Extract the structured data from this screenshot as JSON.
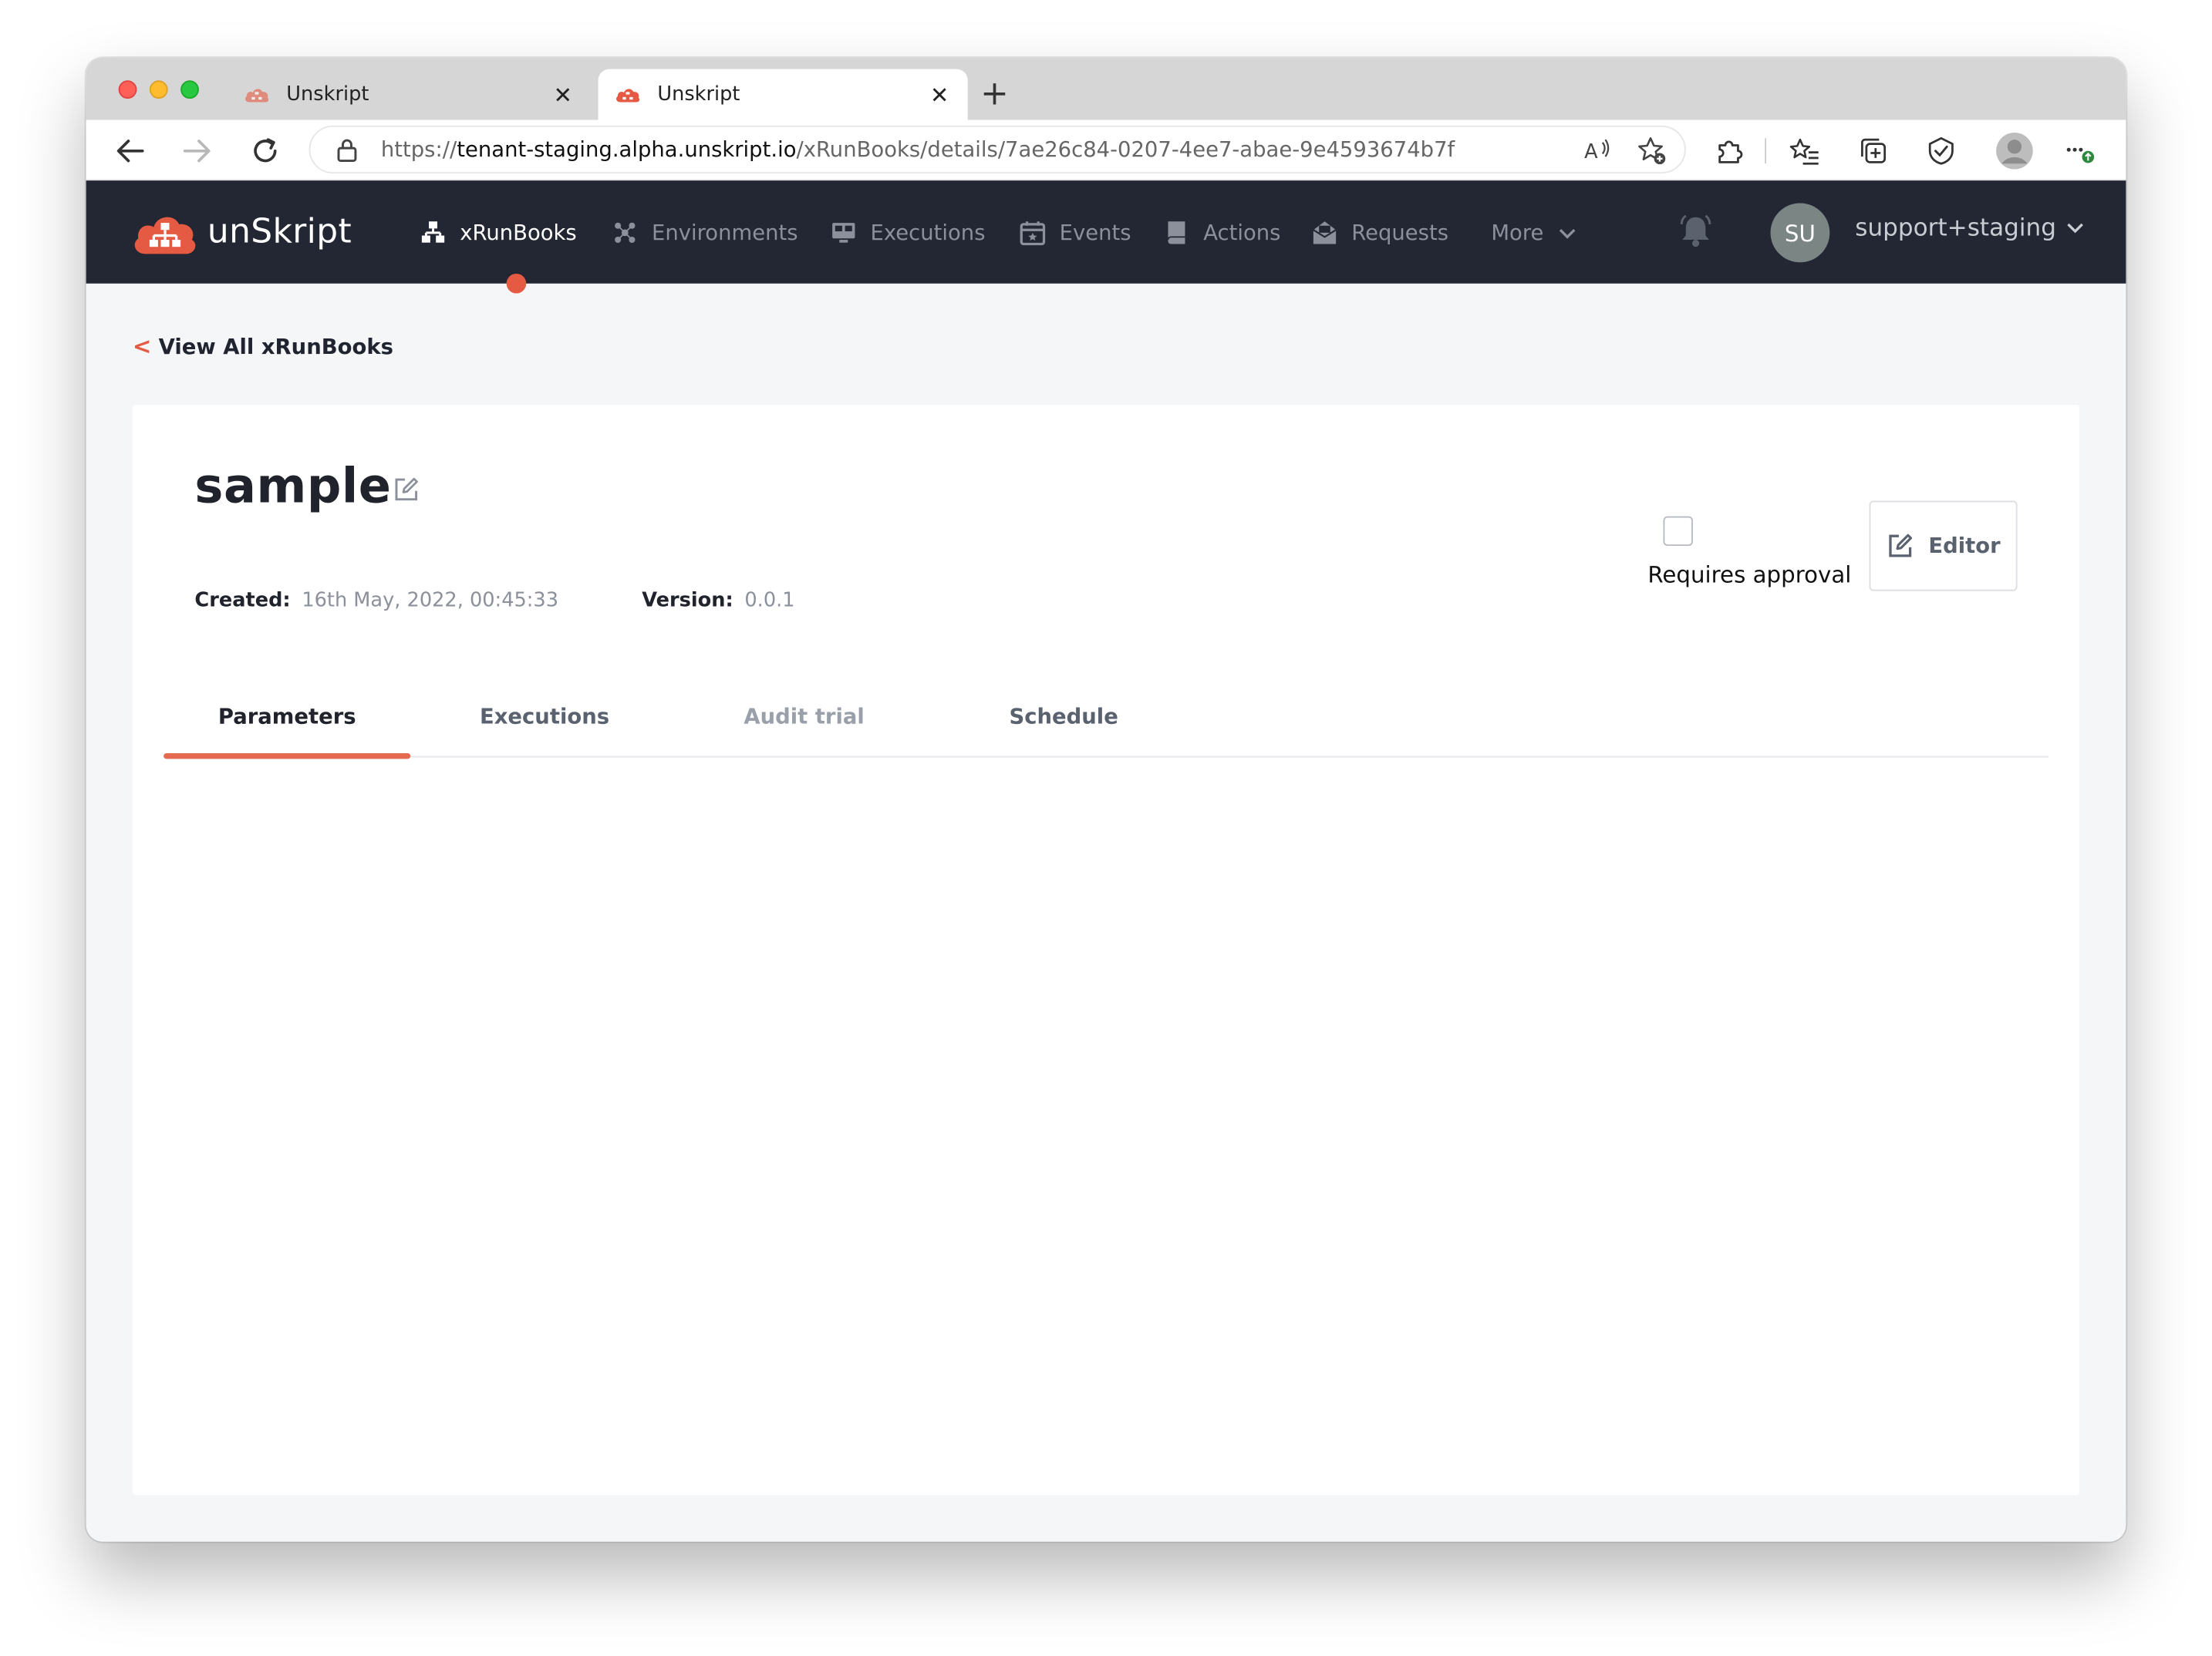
{
  "browser": {
    "tabs": [
      {
        "title": "Unskript",
        "active": false
      },
      {
        "title": "Unskript",
        "active": true
      }
    ],
    "url": {
      "scheme": "https://",
      "host": "tenant-staging.alpha.unskript.io",
      "path": "/xRunBooks/details/7ae26c84-0207-4ee7-abae-9e4593674b7f"
    }
  },
  "app": {
    "brand": "unSkript",
    "nav": {
      "xrunbooks": "xRunBooks",
      "environments": "Environments",
      "executions": "Executions",
      "events": "Events",
      "actions": "Actions",
      "requests": "Requests",
      "more": "More"
    },
    "user": {
      "initials": "SU",
      "name": "support+staging"
    },
    "colors": {
      "nav_bg": "#222733",
      "accent": "#e55a42"
    }
  },
  "page": {
    "back_link": "View All xRunBooks",
    "back_symbol": "<",
    "title": "sample",
    "created_label": "Created:",
    "created_value": "16th May, 2022, 00:45:33",
    "version_label": "Version:",
    "version_value": "0.0.1",
    "requires_approval_label": "Requires approval",
    "requires_approval_checked": false,
    "editor_button": "Editor",
    "tabs": [
      "Parameters",
      "Executions",
      "Audit trial",
      "Schedule"
    ],
    "active_tab": "Parameters"
  }
}
